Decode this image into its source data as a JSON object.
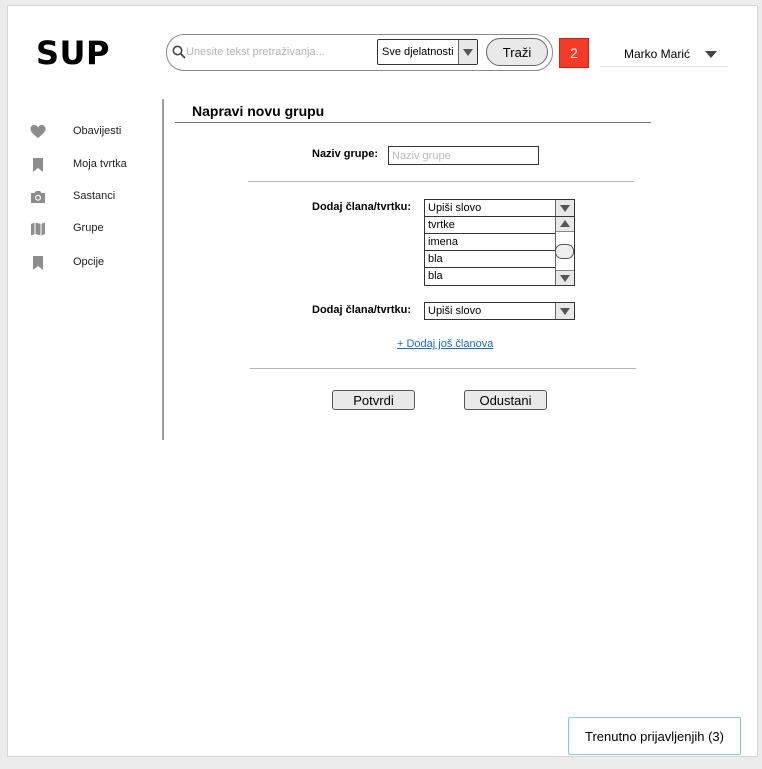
{
  "app": {
    "logo": "SUP"
  },
  "header": {
    "search_placeholder": "Unesite tekst pretraživanja...",
    "category_select": "Sve djelatnosti",
    "search_button": "Traži",
    "notification_count": "2",
    "user_name": "Marko Marić"
  },
  "sidebar": {
    "items": [
      {
        "label": "Obavijesti",
        "icon": "heart-icon"
      },
      {
        "label": "Moja tvrtka",
        "icon": "bookmark-icon"
      },
      {
        "label": "Sastanci",
        "icon": "camera-icon"
      },
      {
        "label": "Grupe",
        "icon": "map-icon"
      },
      {
        "label": "Opcije",
        "icon": "bookmark-icon"
      }
    ]
  },
  "form": {
    "title": "Napravi novu grupu",
    "group_name_label": "Naziv grupe:",
    "group_name_placeholder": "Naziv grupe",
    "member1_label": "Dodaj člana/tvrtku:",
    "member1_value": "Upiši slovo",
    "member1_options": [
      "tvrtke",
      "imena",
      "bla",
      "bla"
    ],
    "member2_label": "Dodaj člana/tvrtku:",
    "member2_value": "Upiši slovo",
    "add_more_link": "+ Dodaj još članova",
    "confirm_button": "Potvrdi",
    "cancel_button": "Odustani"
  },
  "footer": {
    "online_users": "Trenutno prijavljenjih (3)"
  },
  "colors": {
    "notification": "#f53b28",
    "link": "#1a6ad1",
    "online_border": "#7ad0e0"
  }
}
